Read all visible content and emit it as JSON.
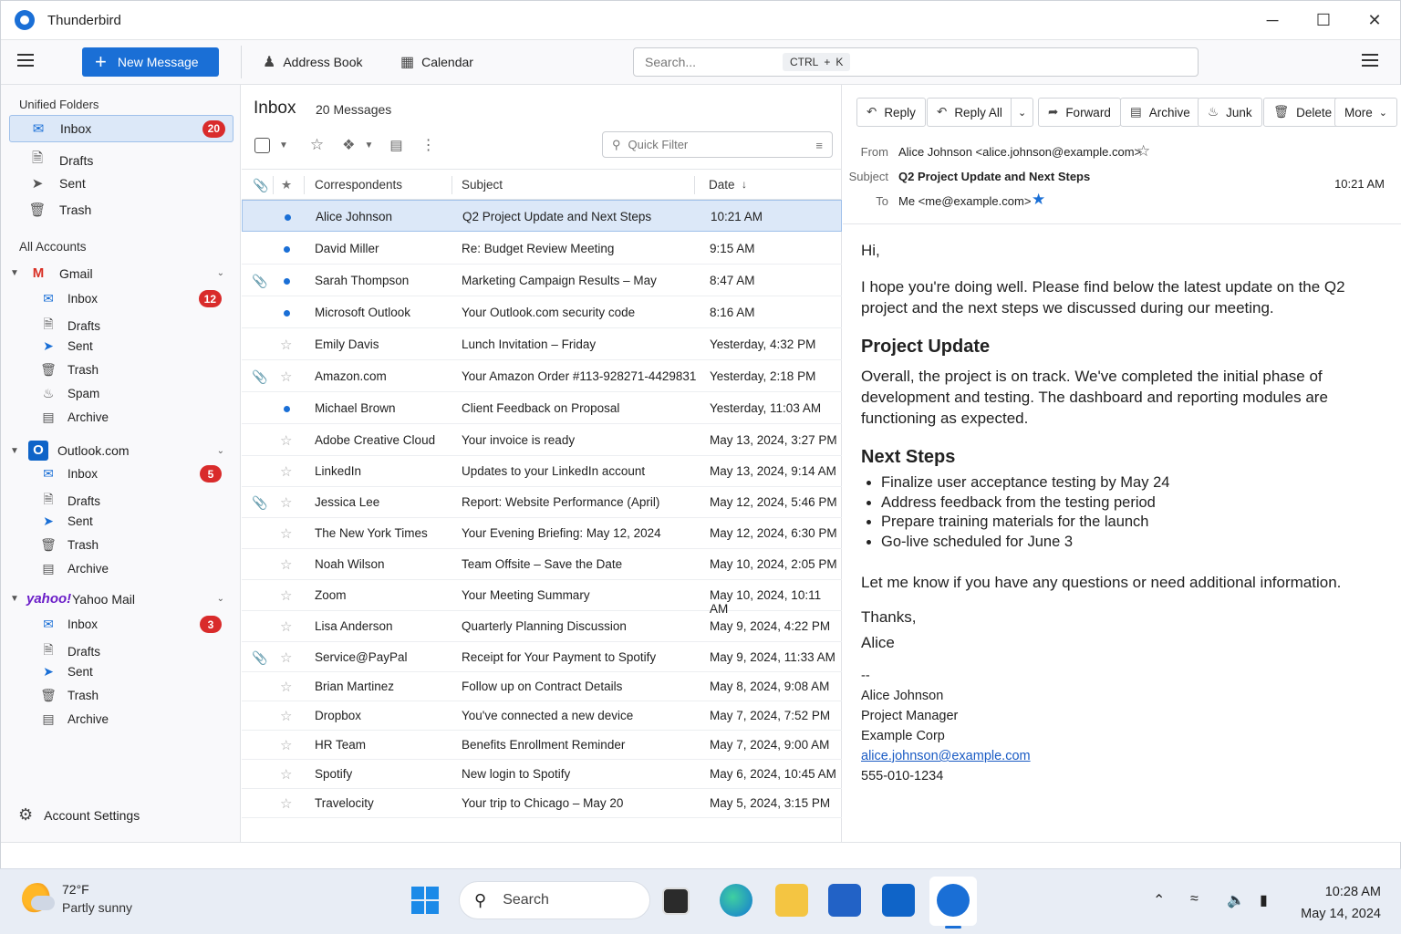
{
  "window": {
    "title": "Thunderbird",
    "controls": [
      "─",
      "☐",
      "✕"
    ]
  },
  "toolbar": {
    "new_message": "New Message",
    "address_book": "Address Book",
    "calendar": "Calendar",
    "search_placeholder": "Search...",
    "shortcut_ctrl": "CTRL",
    "shortcut_plus": "+",
    "shortcut_key": "K"
  },
  "folders": {
    "unified_label": "Unified Folders",
    "unified": [
      {
        "label": "Inbox",
        "badge": "20",
        "icon": "inbox-icon"
      },
      {
        "label": "Drafts",
        "icon": "drafts-icon"
      },
      {
        "label": "Sent",
        "icon": "sent-icon"
      },
      {
        "label": "Trash",
        "icon": "trash-icon"
      }
    ],
    "all_accounts_label": "All Accounts",
    "gmail": {
      "name": "Gmail",
      "logo": "M",
      "items": [
        "Inbox",
        "Drafts",
        "Sent",
        "Trash",
        "Spam",
        "Archive"
      ],
      "inbox_badge": "12"
    },
    "outlook": {
      "name": "Outlook.com",
      "logo": "O",
      "items": [
        "Inbox",
        "Drafts",
        "Sent",
        "Trash",
        "Archive"
      ],
      "inbox_badge": "5"
    },
    "yahoo": {
      "name": "Yahoo Mail",
      "logo": "yahoo!",
      "items": [
        "Inbox",
        "Drafts",
        "Sent",
        "Trash",
        "Archive"
      ],
      "inbox_badge": "3"
    },
    "account_settings": "Account Settings"
  },
  "list": {
    "title": "Inbox",
    "count": "20 Messages",
    "quick_filter": "Quick Filter",
    "columns": {
      "correspondents": "Correspondents",
      "subject": "Subject",
      "date": "Date"
    },
    "messages": [
      {
        "from": "Alice Johnson",
        "subject": "Q2 Project Update and Next Steps",
        "date": "10:21 AM",
        "unread": true,
        "attach": false
      },
      {
        "from": "David Miller",
        "subject": "Re: Budget Review Meeting",
        "date": "9:15 AM",
        "unread": true,
        "attach": false
      },
      {
        "from": "Sarah Thompson",
        "subject": "Marketing Campaign Results – May",
        "date": "8:47 AM",
        "unread": true,
        "attach": true
      },
      {
        "from": "Microsoft Outlook",
        "subject": "Your Outlook.com security code",
        "date": "8:16 AM",
        "unread": true,
        "attach": false
      },
      {
        "from": "Emily Davis",
        "subject": "Lunch Invitation – Friday",
        "date": "Yesterday, 4:32 PM",
        "unread": false,
        "attach": false
      },
      {
        "from": "Amazon.com",
        "subject": "Your Amazon Order #113-928271-4429831",
        "date": "Yesterday, 2:18 PM",
        "unread": false,
        "attach": true
      },
      {
        "from": "Michael Brown",
        "subject": "Client Feedback on Proposal",
        "date": "Yesterday, 11:03 AM",
        "unread": true,
        "attach": false
      },
      {
        "from": "Adobe Creative Cloud",
        "subject": "Your invoice is ready",
        "date": "May 13, 2024, 3:27 PM",
        "unread": false,
        "attach": false
      },
      {
        "from": "LinkedIn",
        "subject": "Updates to your LinkedIn account",
        "date": "May 13, 2024, 9:14 AM",
        "unread": false,
        "attach": false
      },
      {
        "from": "Jessica Lee",
        "subject": "Report: Website Performance (April)",
        "date": "May 12, 2024, 5:46 PM",
        "unread": false,
        "attach": true
      },
      {
        "from": "The New York Times",
        "subject": "Your Evening Briefing: May 12, 2024",
        "date": "May 12, 2024, 6:30 PM",
        "unread": false,
        "attach": false
      },
      {
        "from": "Noah Wilson",
        "subject": "Team Offsite – Save the Date",
        "date": "May 10, 2024, 2:05 PM",
        "unread": false,
        "attach": false
      },
      {
        "from": "Zoom",
        "subject": "Your Meeting Summary",
        "date": "May 10, 2024, 10:11 AM",
        "unread": false,
        "attach": false
      },
      {
        "from": "Lisa Anderson",
        "subject": "Quarterly Planning Discussion",
        "date": "May 9, 2024, 4:22 PM",
        "unread": false,
        "attach": false
      },
      {
        "from": "Service@PayPal",
        "subject": "Receipt for Your Payment to Spotify",
        "date": "May 9, 2024, 11:33 AM",
        "unread": false,
        "attach": true
      },
      {
        "from": "Brian Martinez",
        "subject": "Follow up on Contract Details",
        "date": "May 8, 2024, 9:08 AM",
        "unread": false,
        "attach": false
      },
      {
        "from": "Dropbox",
        "subject": "You've connected a new device",
        "date": "May 7, 2024, 7:52 PM",
        "unread": false,
        "attach": false
      },
      {
        "from": "HR Team",
        "subject": "Benefits Enrollment Reminder",
        "date": "May 7, 2024, 9:00 AM",
        "unread": false,
        "attach": false
      },
      {
        "from": "Spotify",
        "subject": "New login to Spotify",
        "date": "May 6, 2024, 10:45 AM",
        "unread": false,
        "attach": false
      },
      {
        "from": "Travelocity",
        "subject": "Your trip to Chicago – May 20",
        "date": "May 5, 2024, 3:15 PM",
        "unread": false,
        "attach": false
      }
    ]
  },
  "reader": {
    "actions": {
      "reply": "Reply",
      "reply_all": "Reply All",
      "forward": "Forward",
      "archive": "Archive",
      "junk": "Junk",
      "delete": "Delete",
      "more": "More"
    },
    "from_label": "From",
    "from": "Alice Johnson <alice.johnson@example.com>",
    "subject_label": "Subject",
    "subject": "Q2 Project Update and Next Steps",
    "to_label": "To",
    "to": "Me <me@example.com>",
    "time": "10:21 AM",
    "body": {
      "greeting": "Hi,",
      "intro": "I hope you're doing well. Please find below the latest update on the Q2 project and the next steps we discussed during our meeting.",
      "h1": "Project Update",
      "p1": "Overall, the project is on track. We've completed the initial phase of development and testing. The dashboard and reporting modules are functioning as expected.",
      "h2": "Next Steps",
      "steps": [
        "Finalize user acceptance testing by May 24",
        "Address feedback from the testing period",
        "Prepare training materials for the launch",
        "Go-live scheduled for June 3"
      ],
      "closing": "Let me know if you have any questions or need additional information.",
      "thanks": "Thanks,",
      "name": "Alice",
      "sig_dash": "--",
      "sig_name": "Alice Johnson",
      "sig_title": "Project Manager",
      "sig_company": "Example Corp",
      "sig_email": "alice.johnson@example.com",
      "sig_phone": "555-010-1234"
    }
  },
  "taskbar": {
    "temp": "72°F",
    "weather": "Partly sunny",
    "search": "Search",
    "time": "10:28 AM",
    "date": "May 14, 2024"
  }
}
